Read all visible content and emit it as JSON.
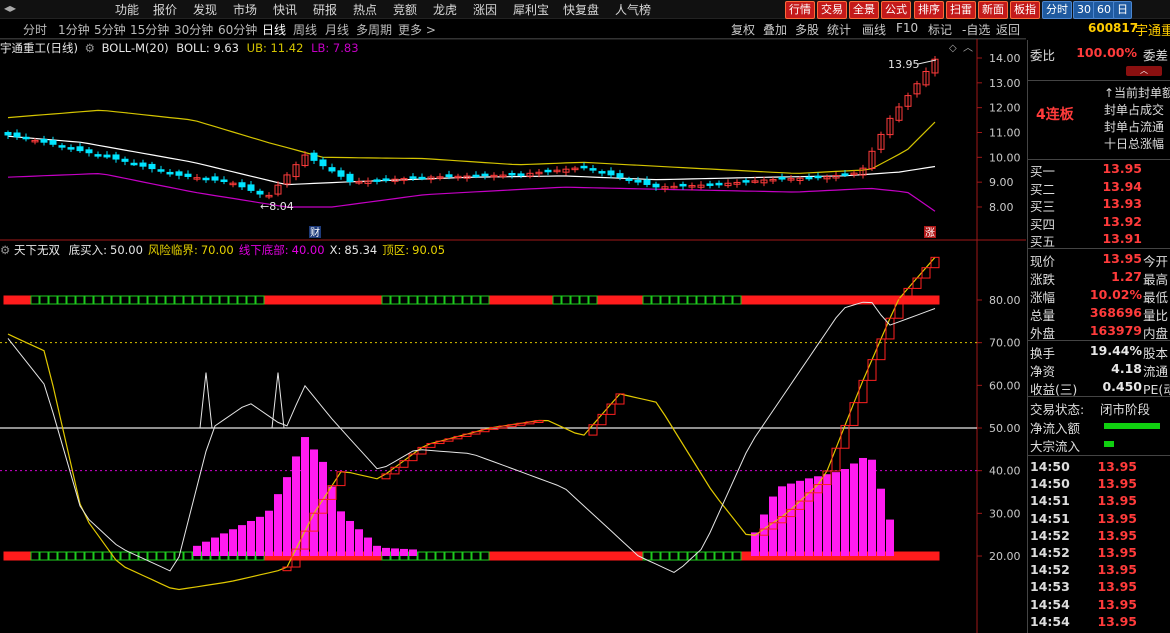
{
  "topbar": {
    "menu": [
      "功能",
      "报价",
      "发现",
      "市场",
      "快讯",
      "研报",
      "热点",
      "竞额",
      "龙虎",
      "涨因",
      "犀利宝",
      "快复盘",
      "人气榜"
    ],
    "quick": [
      "行情",
      "交易",
      "全景",
      "公式",
      "排序",
      "扫雷",
      "新面",
      "板指",
      "分时",
      "30",
      "60",
      "日"
    ]
  },
  "periods": [
    "分时",
    "1分钟",
    "5分钟",
    "15分钟",
    "30分钟",
    "60分钟",
    "日线",
    "周线",
    "月线",
    "多周期",
    "更多 >"
  ],
  "selected_period": "日线",
  "tools": [
    "复权",
    "叠加",
    "多股",
    "统计",
    "画线",
    "F10",
    "标记",
    "-自选",
    "返回"
  ],
  "main_chart": {
    "stock_label": "宇通重工(日线)",
    "indicator": "BOLL-M(20)",
    "boll": "BOLL: 9.63",
    "ub": "UB: 11.42",
    "lb": "LB: 7.83",
    "y_ticks": [
      "14.00",
      "13.00",
      "12.00",
      "11.00",
      "10.00",
      "9.00",
      "8.00"
    ],
    "max_label": "13.95",
    "min_label": "8.04",
    "badge_cai": "财",
    "badge_zhang": "涨",
    "colors": {
      "up": "#ff3b3b",
      "down": "#00e5ff",
      "boll_mid": "#ffffff",
      "ub": "#d4c400",
      "lb": "#c400c4"
    }
  },
  "sub_chart": {
    "name": "天下无双",
    "params": [
      {
        "label": "底买入",
        "value": "50.00",
        "color": "#e6e6e6"
      },
      {
        "label": "风险临界",
        "value": "70.00",
        "color": "#e6d200"
      },
      {
        "label": "线下底部",
        "value": "40.00",
        "color": "#e000e0"
      },
      {
        "label": "X",
        "value": "85.34",
        "color": "#e6e6e6"
      },
      {
        "label": "顶区",
        "value": "90.05",
        "color": "#e6d200"
      }
    ],
    "y_ticks": [
      "80.00",
      "70.00",
      "60.00",
      "50.00",
      "40.00",
      "30.00",
      "20.00"
    ]
  },
  "right_panel": {
    "code": "600817",
    "name": "宇通重工",
    "webi_label": "委比",
    "webi_value": "100.00%",
    "webi_extra": "委差",
    "lianban": "4连板",
    "notes": [
      "↑当前封单额",
      "封单占成交",
      "封单占流通",
      "十日总涨幅"
    ],
    "bids": [
      {
        "label": "买一",
        "price": "13.95"
      },
      {
        "label": "买二",
        "price": "13.94"
      },
      {
        "label": "买三",
        "price": "13.93"
      },
      {
        "label": "买四",
        "price": "13.92"
      },
      {
        "label": "买五",
        "price": "13.91"
      }
    ],
    "stats": [
      {
        "label": "现价",
        "value": "13.95",
        "extra": "今开"
      },
      {
        "label": "涨跌",
        "value": "1.27",
        "extra": "最高"
      },
      {
        "label": "涨幅",
        "value": "10.02%",
        "extra": "最低"
      },
      {
        "label": "总量",
        "value": "368696",
        "extra": "量比"
      },
      {
        "label": "外盘",
        "value": "163979",
        "extra": "内盘"
      }
    ],
    "stats2": [
      {
        "label": "换手",
        "value": "19.44%",
        "extra": "股本"
      },
      {
        "label": "净资",
        "value": "4.18",
        "extra": "流通"
      },
      {
        "label": "收益(三)",
        "value": "0.450",
        "extra": "PE(动"
      }
    ],
    "trade_status_label": "交易状态:",
    "trade_status_value": "闭市阶段",
    "net_inflow_label": "净流入额",
    "block_inflow_label": "大宗流入",
    "ticks": [
      {
        "time": "14:50",
        "price": "13.95"
      },
      {
        "time": "14:50",
        "price": "13.95"
      },
      {
        "time": "14:51",
        "price": "13.95"
      },
      {
        "time": "14:51",
        "price": "13.95"
      },
      {
        "time": "14:52",
        "price": "13.95"
      },
      {
        "time": "14:52",
        "price": "13.95"
      },
      {
        "time": "14:52",
        "price": "13.95"
      },
      {
        "time": "14:53",
        "price": "13.95"
      },
      {
        "time": "14:54",
        "price": "13.95"
      },
      {
        "time": "14:54",
        "price": "13.95"
      }
    ]
  }
}
